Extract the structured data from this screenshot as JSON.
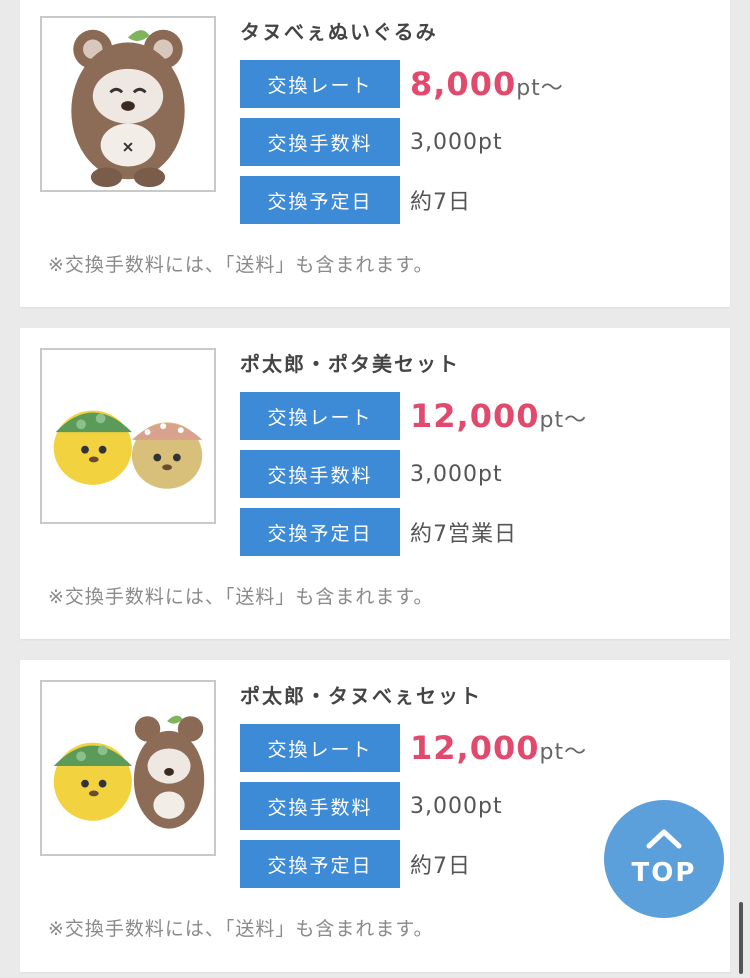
{
  "items": [
    {
      "name": "タヌべぇぬいぐるみ",
      "rate_label": "交換レート",
      "rate_value": "8,000",
      "rate_unit": "pt〜",
      "fee_label": "交換手数料",
      "fee_value": "3,000pt",
      "date_label": "交換予定日",
      "date_value": "約7日",
      "note": "※交換手数料には、「送料」も含まれます。"
    },
    {
      "name": "ポ太郎・ポタ美セット",
      "rate_label": "交換レート",
      "rate_value": "12,000",
      "rate_unit": "pt〜",
      "fee_label": "交換手数料",
      "fee_value": "3,000pt",
      "date_label": "交換予定日",
      "date_value": "約7営業日",
      "note": "※交換手数料には、「送料」も含まれます。"
    },
    {
      "name": "ポ太郎・タヌべぇセット",
      "rate_label": "交換レート",
      "rate_value": "12,000",
      "rate_unit": "pt〜",
      "fee_label": "交換手数料",
      "fee_value": "3,000pt",
      "date_label": "交換予定日",
      "date_value": "約7日",
      "note": "※交換手数料には、「送料」も含まれます。"
    }
  ],
  "top_button": {
    "label": "TOP",
    "icon": "chevron-up-icon"
  },
  "colors": {
    "label_bg": "#3d8bd6",
    "rate_text": "#e14a6d",
    "top_button_bg": "#5b9fdb",
    "page_bg": "#eaeaea"
  }
}
